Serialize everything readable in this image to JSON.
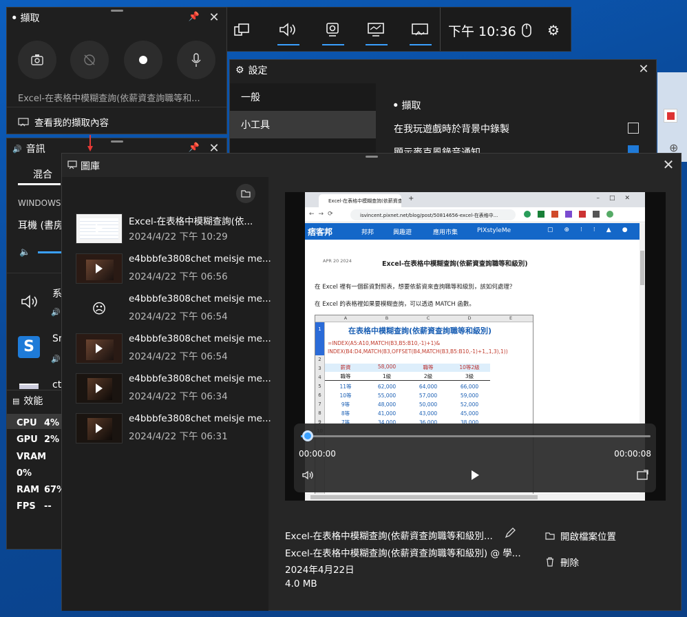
{
  "gamebar": {
    "time": "下午 10:36"
  },
  "capture": {
    "title": "擷取",
    "last_capture": "Excel-在表格中模糊查詢(依薪資查詢職等和...",
    "view_link": "查看我的擷取內容"
  },
  "audio": {
    "title": "音訊",
    "tab_mix": "混合",
    "device_section": "WINDOWS 預",
    "device": "耳機 (書房",
    "app1": "系",
    "app2": "Sn",
    "app3": "ctf"
  },
  "perf": {
    "title": "效能",
    "rows": [
      {
        "k": "CPU",
        "v": "4%"
      },
      {
        "k": "GPU",
        "v": "2%"
      },
      {
        "k": "VRAM",
        "v": "0%"
      },
      {
        "k": "RAM",
        "v": "67%"
      },
      {
        "k": "FPS",
        "v": "--"
      }
    ]
  },
  "settings": {
    "title": "設定",
    "nav": [
      "一般",
      "小工具"
    ],
    "section": "擷取",
    "opt1": "在我玩遊戲時於背景中錄製",
    "opt2": "顯示麥克風錄音通知"
  },
  "gallery": {
    "title": "圖庫",
    "items": [
      {
        "name": "Excel-在表格中模糊查詢(依...",
        "date": "2024/4/22 下午 10:29"
      },
      {
        "name": "e4bbbfe3808chet meisje me...",
        "date": "2024/4/22 下午 06:56"
      },
      {
        "name": "e4bbbfe3808chet meisje me...",
        "date": "2024/4/22 下午 06:54"
      },
      {
        "name": "e4bbbfe3808chet meisje me...",
        "date": "2024/4/22 下午 06:54"
      },
      {
        "name": "e4bbbfe3808chet meisje me...",
        "date": "2024/4/22 下午 06:34"
      },
      {
        "name": "e4bbbfe3808chet meisje me...",
        "date": "2024/4/22 下午 06:31"
      }
    ],
    "player": {
      "current": "00:00:00",
      "total": "00:00:08",
      "progress": 0.02
    },
    "detail": {
      "title": "Excel-在表格中模糊查詢(依薪資查詢職等和級別...",
      "subtitle": "Excel-在表格中模糊查詢(依薪資查詢職等和級別) @ 學...",
      "date": "2024年4月22日",
      "size": "4.0 MB"
    },
    "open_location": "開啟檔案位置",
    "delete": "刪除"
  },
  "browser": {
    "tab": "Excel-在表格中模糊查詢(依薪資查詢",
    "url": "isvincent.pixnet.net/blog/post/50814656-excel-在表格中...",
    "brand": "痞客邦",
    "nav": [
      "邦邦",
      "興趣遊",
      "應用市集",
      "PIXstyleMe"
    ],
    "post_date": "APR 20 2024",
    "post_title": "Excel-在表格中模糊查詢(依薪資查詢職等和級別)",
    "para1": "在 Excel 裡有一個薪資對照表，想要依薪資來查詢職等和級別，該如何處理？",
    "para2": "在 Excel 的表格裡如果要模糊查詢，可以透過 MATCH 函數。",
    "sheet": {
      "cols": [
        "A",
        "B",
        "C",
        "D",
        "E"
      ],
      "title": "在表格中模糊查詢(依薪資查詢職等和級別)",
      "formula1": "=INDEX(A5:A10,MATCH(B3,B5:B10,-1)+1)&",
      "formula2": "INDEX(B4:D4,MATCH(B3,OFFSET(B4,MATCH(B3,B5:B10,-1)+1,,1,3),1))",
      "r3": [
        "薪資",
        "58,000",
        "職等",
        "10等2級"
      ],
      "r4": [
        "職等",
        "1級",
        "2級",
        "3級"
      ],
      "rows": [
        [
          "11等",
          "62,000",
          "64,000",
          "66,000"
        ],
        [
          "10等",
          "55,000",
          "57,000",
          "59,000"
        ],
        [
          "9等",
          "48,000",
          "50,000",
          "52,000"
        ],
        [
          "8等",
          "41,000",
          "43,000",
          "45,000"
        ],
        [
          "7等",
          "34,000",
          "36,000",
          "38,000"
        ]
      ]
    }
  }
}
